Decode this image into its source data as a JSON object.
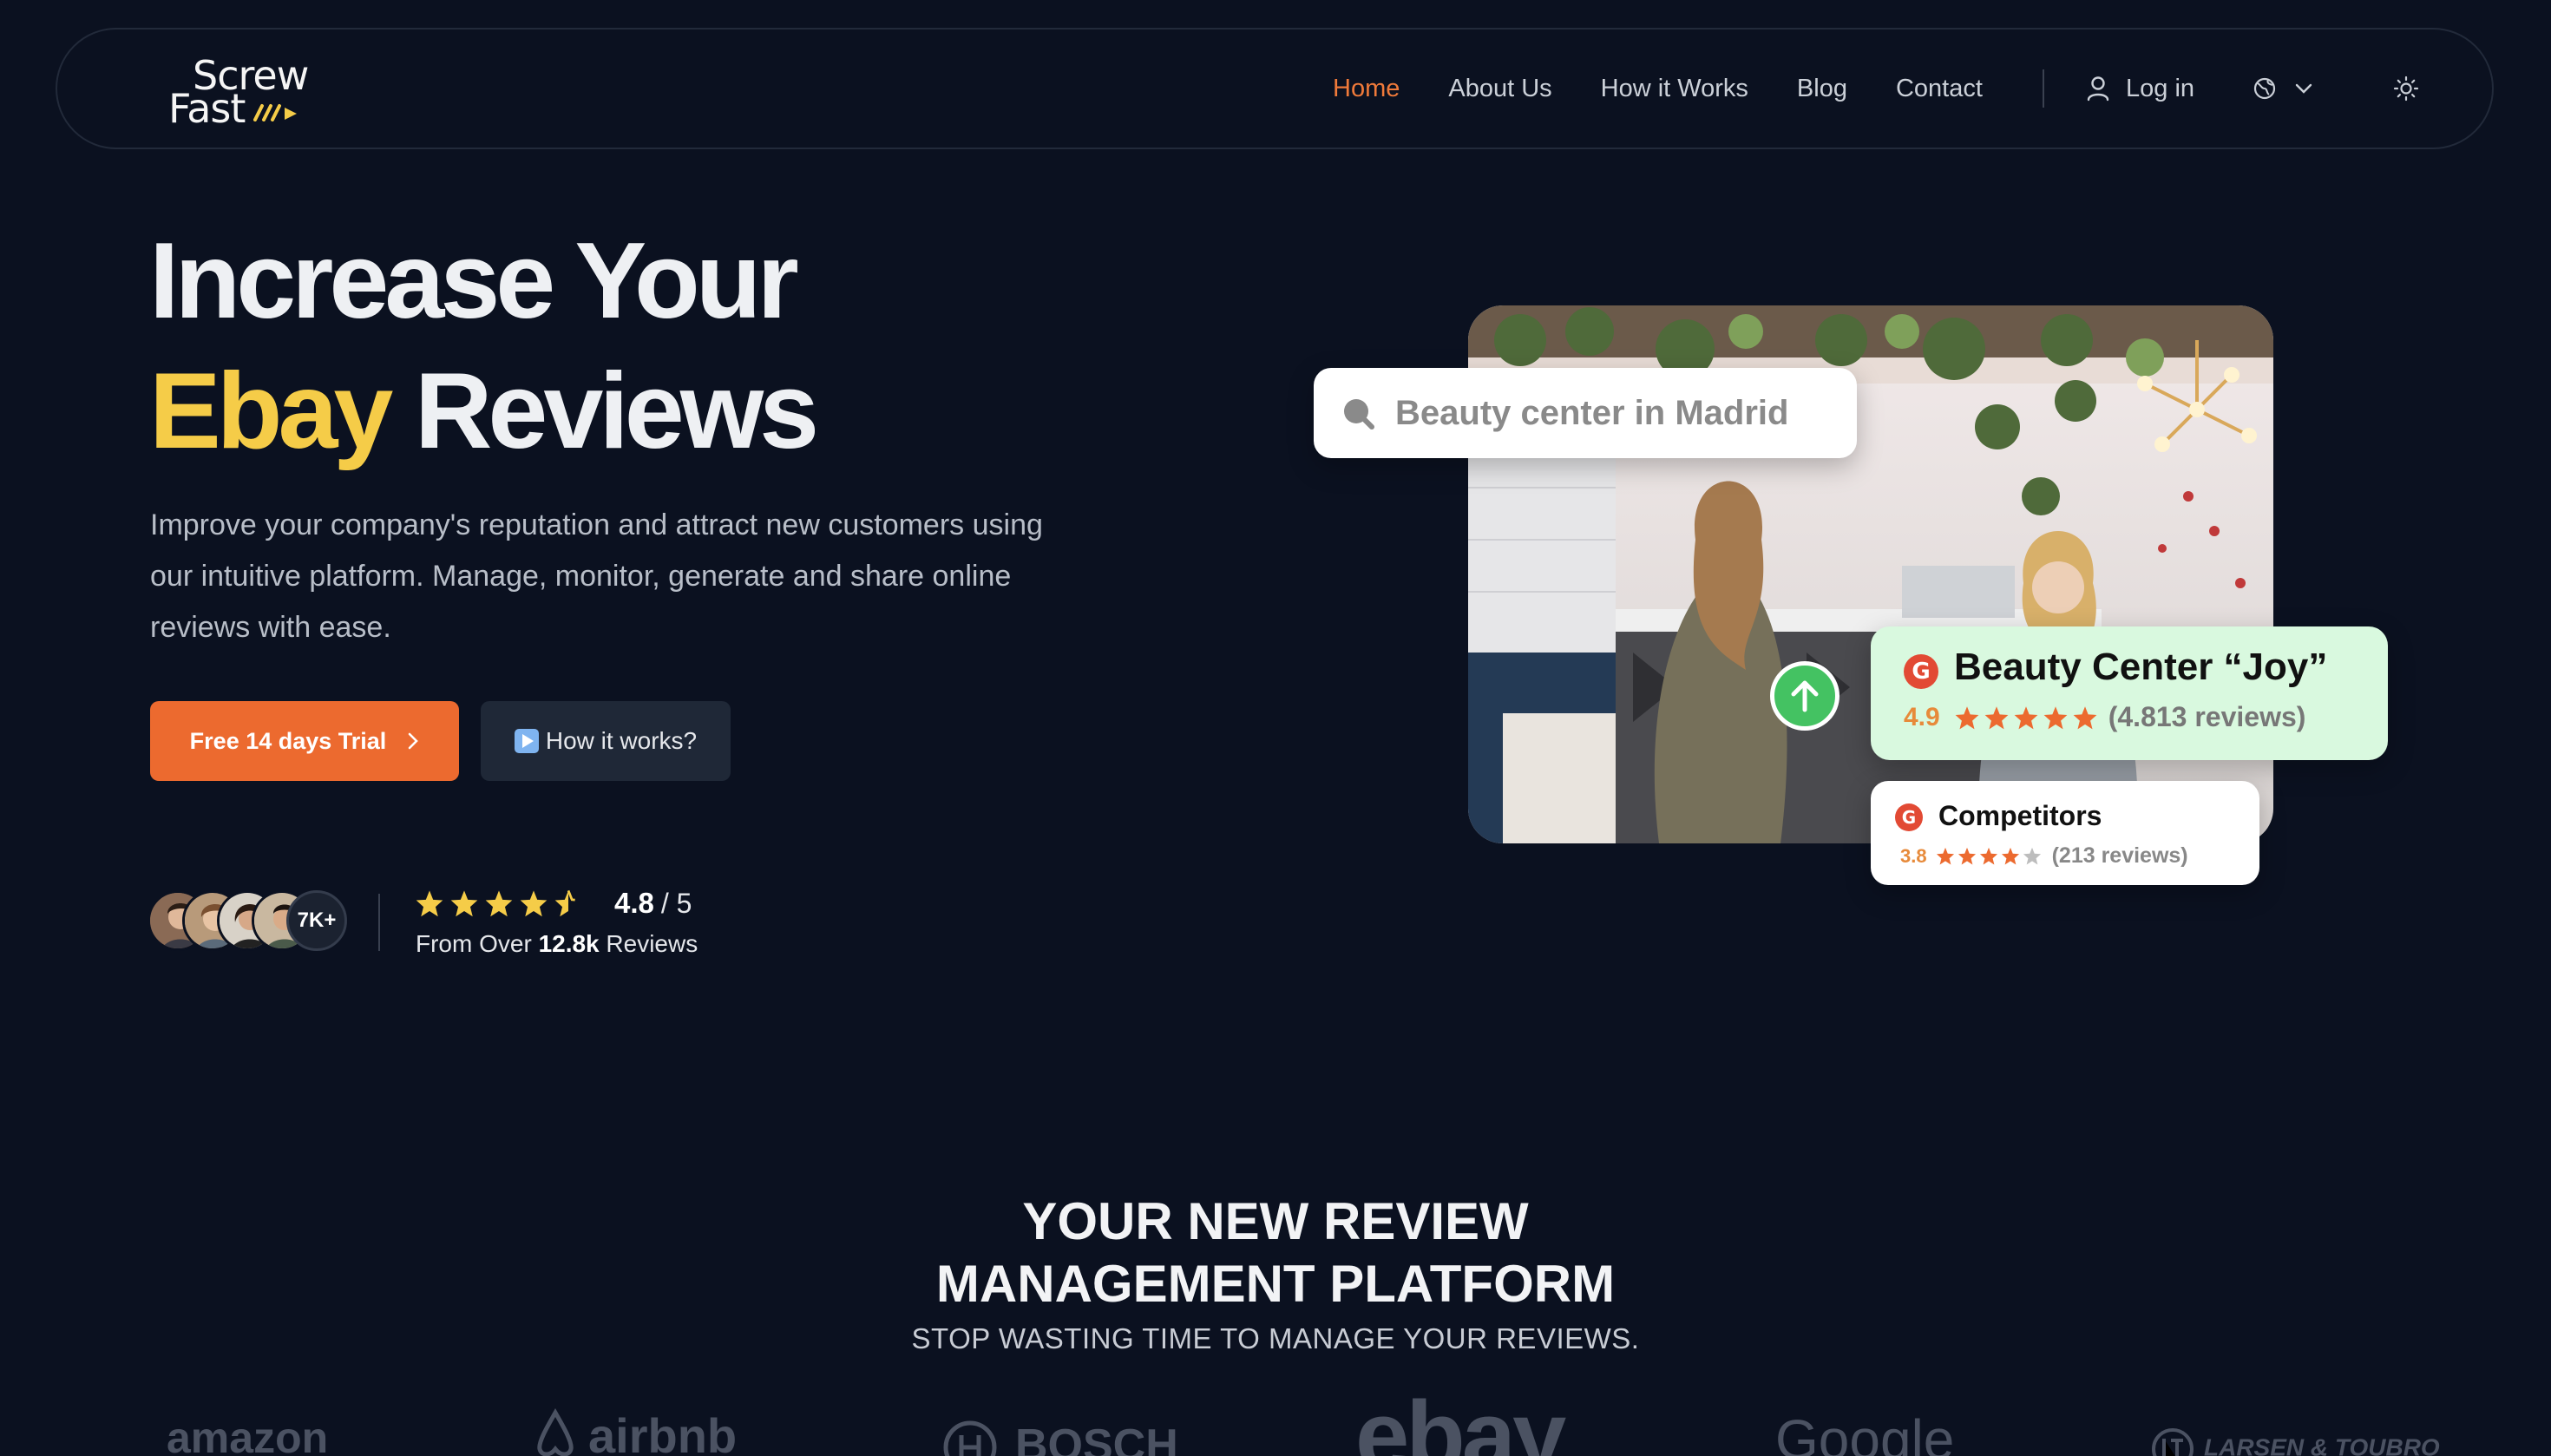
{
  "logo": {
    "line1": "Screw",
    "line2": "Fast"
  },
  "nav": {
    "links": [
      {
        "label": "Home",
        "active": true
      },
      {
        "label": "About Us",
        "active": false
      },
      {
        "label": "How it Works",
        "active": false
      },
      {
        "label": "Blog",
        "active": false
      },
      {
        "label": "Contact",
        "active": false
      }
    ],
    "login_label": "Log in",
    "language_icon": "globe-icon",
    "theme_icon": "sun-icon"
  },
  "hero": {
    "title_line1": "Increase Your",
    "title_accent": "Ebay",
    "title_rest": "Reviews",
    "description": "Improve your company's reputation and attract new customers using our intuitive platform. Manage, monitor, generate and share online reviews with ease.",
    "cta_primary": "Free 14 days Trial",
    "cta_secondary": "How it works?",
    "avatars_more": "7K+",
    "rating_value": "4.8",
    "rating_max": "/ 5",
    "rating_stars": 4.5,
    "rating_sub_prefix": "From Over",
    "rating_sub_count": "12.8k",
    "rating_sub_suffix": "Reviews"
  },
  "showcase": {
    "search_text": "Beauty center in Madrid",
    "business": {
      "name": "Beauty Center “Joy”",
      "score": "4.9",
      "stars": 5,
      "reviews": "(4.813 reviews)"
    },
    "competitors": {
      "name": "Competitors",
      "score": "3.8",
      "stars": 4,
      "reviews": "(213 reviews)"
    }
  },
  "section": {
    "title_line1": "YOUR NEW REVIEW",
    "title_line2": "MANAGEMENT PLATFORM",
    "subtitle": "STOP WASTING TIME TO MANAGE YOUR REVIEWS."
  },
  "brands": [
    "amazon",
    "airbnb",
    "BOSCH",
    "ebay",
    "Google",
    "LARSEN & TOUBRO"
  ],
  "colors": {
    "background": "#0b1120",
    "accent_orange": "#ec6a2f",
    "accent_yellow": "#f5cc48",
    "business_card": "#d9f9df",
    "google_red": "#e24a34"
  }
}
